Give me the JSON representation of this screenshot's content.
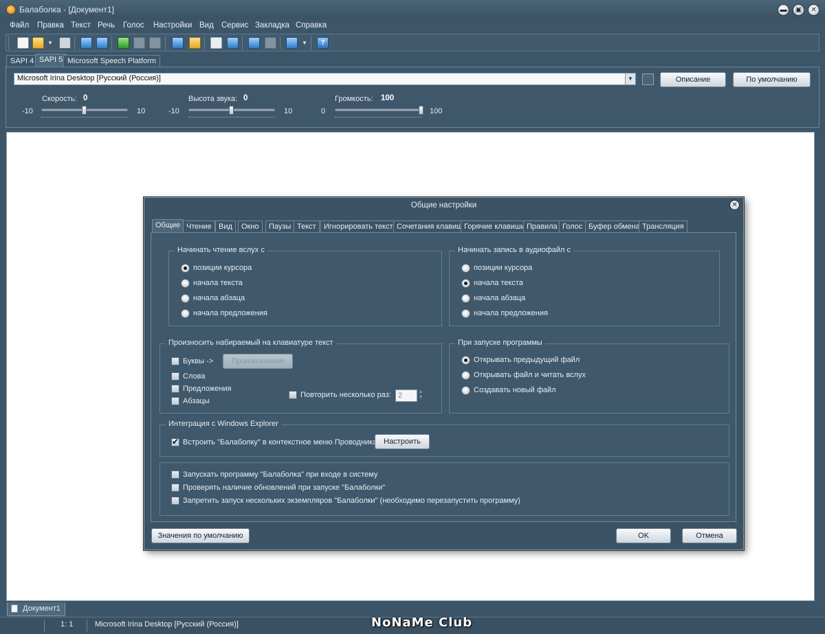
{
  "window": {
    "title": "Балаболка - [Документ1]",
    "min": "▬",
    "max": "▣",
    "close": "✕"
  },
  "menu": [
    "Файл",
    "Правка",
    "Текст",
    "Речь",
    "Голос",
    "Настройки",
    "Вид",
    "Сервис",
    "Закладка",
    "Справка"
  ],
  "toolbar": {
    "help": "?",
    "dropdown": "▼"
  },
  "engine_tabs": [
    "SAPI 4",
    "SAPI 5",
    "Microsoft Speech Platform"
  ],
  "voice": {
    "selected": "Microsoft Irina Desktop [Русский (Россия)]",
    "dropdown": "▼",
    "describe_button": "Описание",
    "default_button": "По умолчанию",
    "speed": {
      "label": "Скорость:",
      "value": "0",
      "min": "-10",
      "max": "10",
      "level": 0
    },
    "pitch": {
      "label": "Высота звука:",
      "value": "0",
      "min": "-10",
      "max": "10",
      "level": 0
    },
    "volume": {
      "label": "Громкость:",
      "value": "100",
      "min": "0",
      "max": "100",
      "level": 100
    }
  },
  "doc_tab": "Документ1",
  "status": {
    "position": "1:   1",
    "voice": "Microsoft Irina Desktop [Русский (Россия)]"
  },
  "watermark": "NoNaMe Club",
  "dialog": {
    "title": "Общие настройки",
    "close": "✕",
    "tabs": [
      "Общие",
      "Чтение",
      "Вид",
      "Окно",
      "Паузы",
      "Текст",
      "Игнорировать текст",
      "Сочетания клавиш",
      "Горячие клавиши",
      "Правила",
      "Голос",
      "Буфер обмена",
      "Трансляция"
    ],
    "read_from": {
      "title": "Начинать чтение вслух с",
      "options": [
        "позиции курсора",
        "начала текста",
        "начала абзаца",
        "начала предложения"
      ],
      "selected": 0
    },
    "record_from": {
      "title": "Начинать запись в аудиофайл с",
      "options": [
        "позиции курсора",
        "начала текста",
        "начала абзаца",
        "начала предложения"
      ],
      "selected": 1
    },
    "typing": {
      "title": "Произносить набираемый на клавиатуре текст",
      "letters": "Буквы  ->",
      "pronounce_button": "Произношение",
      "words": "Слова",
      "sentences": "Предложения",
      "paragraphs": "Абзацы",
      "repeat_label": "Повторить несколько раз:",
      "repeat_value": "2",
      "spin_up": "▲",
      "spin_down": "▼"
    },
    "startup": {
      "title": "При запуске программы",
      "options": [
        "Открывать предыдущий файл",
        "Открывать файл и читать вслух",
        "Создавать новый файл"
      ],
      "selected": 0
    },
    "explorer": {
      "title": "Интеграция с Windows Explorer",
      "embed_label": "Встроить \"Балаболку\" в контекстное меню Проводника",
      "embed_checked": true,
      "configure_button": "Настроить"
    },
    "misc": [
      "Запускать программу \"Балаболка\" при входе в систему",
      "Проверять наличие обновлений при запуске \"Балаболки\"",
      "Запретить запуск нескольких экземпляров \"Балаболки\" (необходимо перезапустить программу)"
    ],
    "defaults_button": "Значения по умолчанию",
    "ok_button": "OK",
    "cancel_button": "Отмена"
  }
}
